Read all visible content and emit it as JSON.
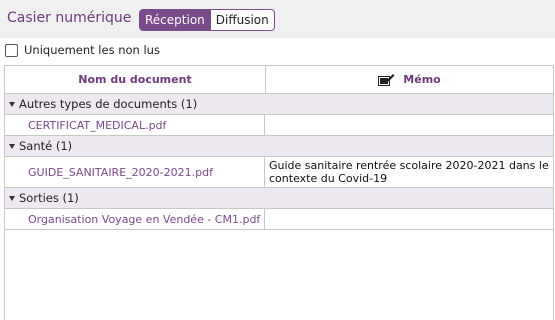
{
  "header": {
    "title": "Casier numérique",
    "tabs": [
      {
        "label": "Réception",
        "active": true
      },
      {
        "label": "Diffusion",
        "active": false
      }
    ]
  },
  "filter": {
    "label": "Uniquement les non lus",
    "checked": false
  },
  "table": {
    "columns": [
      {
        "label": "Nom du document"
      },
      {
        "label": "Mémo",
        "icon": "memo-edit-icon"
      }
    ],
    "groups": [
      {
        "label": "Autres types de documents (1)",
        "rows": [
          {
            "document": "CERTIFICAT_MEDICAL.pdf",
            "memo": ""
          }
        ]
      },
      {
        "label": "Santé (1)",
        "rows": [
          {
            "document": "GUIDE_SANITAIRE_2020-2021.pdf",
            "memo": "Guide sanitaire rentrée scolaire 2020-2021 dans le contexte du Covid-19"
          }
        ]
      },
      {
        "label": "Sorties (1)",
        "rows": [
          {
            "document": "Organisation Voyage en Vendée - CM1.pdf",
            "memo": ""
          }
        ]
      }
    ]
  },
  "colors": {
    "accent": "#7a4a8a",
    "group_bg": "#eee8f0",
    "topbar_bg": "#f0f0f0"
  }
}
